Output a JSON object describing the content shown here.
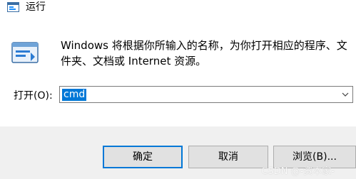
{
  "window": {
    "title": "运行",
    "title_icon": "run-dialog-icon"
  },
  "content": {
    "icon": "run-program-icon",
    "description": "Windows 将根据你所输入的名称，为你打开相应的程序、文件夹、文档或 Internet 资源。"
  },
  "open_field": {
    "label": "打开(O):",
    "value": "cmd",
    "dropdown_icon": "chevron-down-icon"
  },
  "buttons": {
    "ok": "确定",
    "cancel": "取消",
    "browse": "浏览(B)..."
  },
  "watermark": "CSDN @-资本家-",
  "colors": {
    "accent": "#0078d7",
    "footer_bg": "#f0f0f0",
    "button_bg": "#e1e1e1"
  }
}
